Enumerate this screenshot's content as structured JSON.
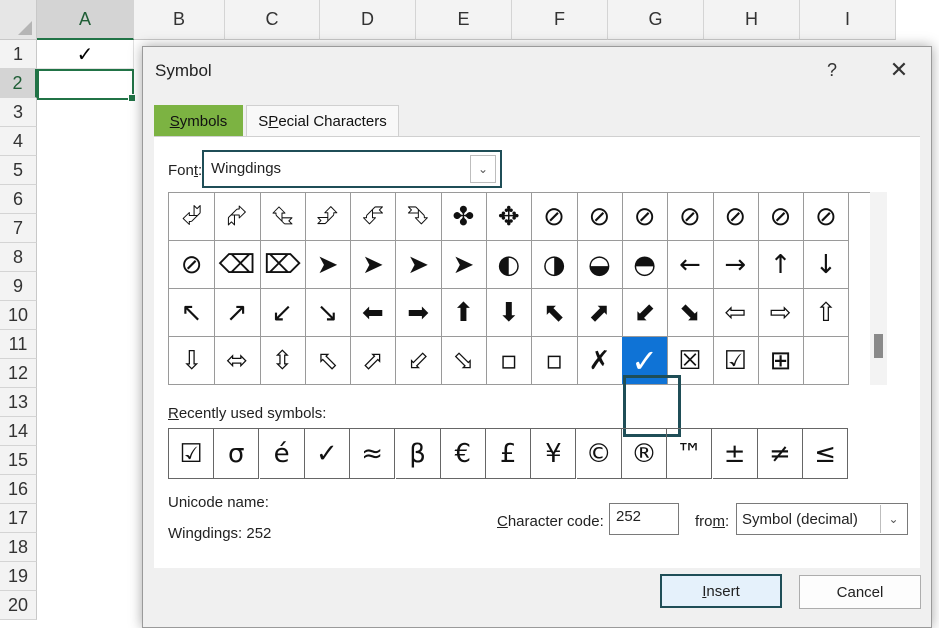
{
  "sheet": {
    "columns": [
      "A",
      "B",
      "C",
      "D",
      "E",
      "F",
      "G",
      "H",
      "I"
    ],
    "selected_column": "A",
    "rows": [
      "1",
      "2",
      "3",
      "4",
      "5",
      "6",
      "7",
      "8",
      "9",
      "10",
      "11",
      "12",
      "13",
      "14",
      "15",
      "16",
      "17",
      "18",
      "19",
      "20"
    ],
    "selected_row": "2",
    "a1_value": "✓"
  },
  "dialog": {
    "title": "Symbol",
    "help_label": "?",
    "close_label": "✕",
    "tabs": {
      "symbols_prefix": "",
      "symbols_accel": "S",
      "symbols_rest": "ymbols",
      "special_prefix": "",
      "special_accel": "P",
      "special_rest": "ecial Characters",
      "special_head": "S"
    },
    "font_label_prefix": "Fon",
    "font_label_accel": "t",
    "font_label_suffix": ":",
    "font_value": "Wingdings",
    "symbol_grid": [
      [
        "⮰",
        "⮳",
        "⮴",
        "⮵",
        "⮶",
        "⮷",
        "✤",
        "✥",
        "⊘",
        "⊘",
        "⊘",
        "⊘",
        "⊘",
        "⊘",
        "⊘"
      ],
      [
        "⊘",
        "⌫",
        "⌦",
        "➤",
        "➤",
        "➤",
        "➤",
        "◐",
        "◑",
        "◒",
        "◓",
        "←",
        "→",
        "↑",
        "↓"
      ],
      [
        "↖",
        "↗",
        "↙",
        "↘",
        "⬅",
        "➡",
        "⬆",
        "⬇",
        "⬉",
        "⬈",
        "⬋",
        "⬊",
        "⇦",
        "⇨",
        "⇧"
      ],
      [
        "⇩",
        "⬄",
        "⇳",
        "⬁",
        "⬀",
        "⬃",
        "⬂",
        "▫",
        "▫",
        "✗",
        "✓",
        "☒",
        "☑",
        "⊞",
        ""
      ]
    ],
    "selected_symbol": "✓",
    "recent_label_accel": "R",
    "recent_label_rest": "ecently used symbols:",
    "recent_symbols": [
      "☑",
      "σ",
      "é",
      "✓",
      "≈",
      "β",
      "€",
      "£",
      "¥",
      "©",
      "®",
      "™",
      "±",
      "≠",
      "≤"
    ],
    "unicode_name_label": "Unicode name:",
    "unicode_name_value": "Wingdings: 252",
    "char_code_label_accel": "C",
    "char_code_label_rest": "haracter code:",
    "char_code_value": "252",
    "from_label_prefix": "fro",
    "from_label_accel": "m",
    "from_label_suffix": ":",
    "from_value": "Symbol (decimal)",
    "insert_accel": "I",
    "insert_rest": "nsert",
    "cancel_label": "Cancel"
  }
}
